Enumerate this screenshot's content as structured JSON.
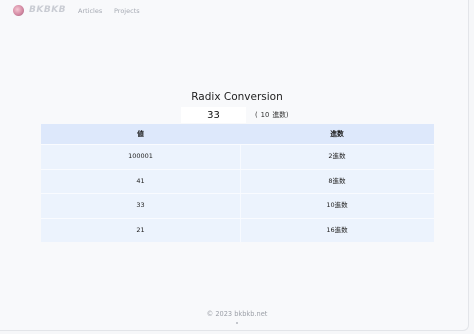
{
  "navbar": {
    "brand": "BKBKB",
    "links": [
      {
        "label": "Articles"
      },
      {
        "label": "Projects"
      }
    ]
  },
  "converter": {
    "title": "Radix Conversion",
    "input_value": "33",
    "radix_open": "(",
    "radix_value": "10",
    "radix_unit": "進数)"
  },
  "table": {
    "headers": [
      "値",
      "進数"
    ],
    "rows": [
      {
        "value": "100001",
        "radix": "2進数"
      },
      {
        "value": "41",
        "radix": "8進数"
      },
      {
        "value": "33",
        "radix": "10進数"
      },
      {
        "value": "21",
        "radix": "16進数"
      }
    ]
  },
  "footer": {
    "copyright": "© 2023 bkbkb.net"
  },
  "colors": {
    "header_bg": "#dde8fb",
    "row_bg": "#ecf3fd",
    "page_bg": "#f8f9fb"
  }
}
